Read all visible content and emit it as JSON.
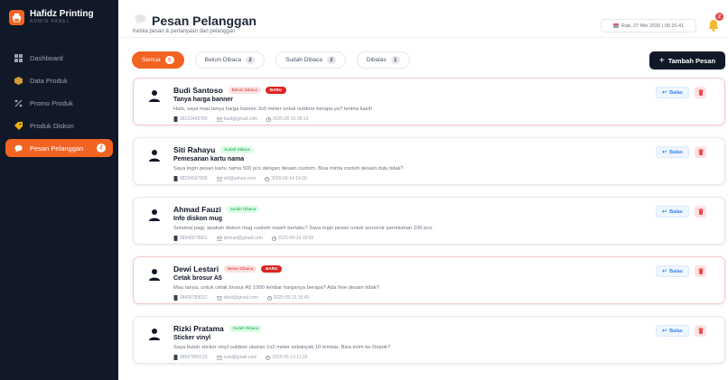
{
  "brand": {
    "title": "Hafidz Printing",
    "subtitle": "ADMIN PANEL",
    "accent": "#f26322"
  },
  "sidebar": {
    "items": [
      {
        "label": "Dashboard",
        "icon": "grid-icon"
      },
      {
        "label": "Data Produk",
        "icon": "box-icon"
      },
      {
        "label": "Promo Produk",
        "icon": "percent-icon"
      },
      {
        "label": "Produk Diskon",
        "icon": "tag-icon"
      },
      {
        "label": "Pesan Pelanggan",
        "icon": "chat-icon",
        "active": true,
        "badge": "2"
      }
    ]
  },
  "header": {
    "title": "Pesan Pelanggan",
    "subtitle": "Kelola pesan & pertanyaan dari pelanggan",
    "datetime": "Rab, 27 Mei 2026 | 09.20.41",
    "notification_count": "2"
  },
  "filters": [
    {
      "label": "Semua",
      "count": "5",
      "active": true
    },
    {
      "label": "Belum Dibaca",
      "count": "2"
    },
    {
      "label": "Sudah Dibaca",
      "count": "2"
    },
    {
      "label": "Dibalas",
      "count": "1"
    }
  ],
  "actions": {
    "add_label": "Tambah Pesan",
    "reply_label": "Balas"
  },
  "messages": [
    {
      "name": "Budi Santoso",
      "status": "Belum Dibaca",
      "is_new": true,
      "new_label": "BARU",
      "subject": "Tanya harga banner",
      "message": "Halo, saya mau tanya harga banner 3x5 meter untuk outdoor berapa ya? terima kasih",
      "phone": "08123456789",
      "email": "budi@gmail.com",
      "date": "2025-05-15 09:12"
    },
    {
      "name": "Siti Rahayu",
      "status": "Sudah Dibaca",
      "is_new": false,
      "subject": "Pemesanan kartu nama",
      "message": "Saya ingin pesan kartu nama 500 pcs dengan desain custom. Bisa minta contoh desain dulu tidak?",
      "phone": "08234567890",
      "email": "siti@yahoo.com",
      "date": "2025-05-14 14:30"
    },
    {
      "name": "Ahmad Fauzi",
      "status": "Sudah Dibaca",
      "is_new": false,
      "subject": "Info diskon mug",
      "message": "Selamat pagi, apakah diskon mug custom masih berlaku? Saya ingin pesan untuk souvenir pernikahan 100 pcs.",
      "phone": "08345678901",
      "email": "ahmad@gmail.com",
      "date": "2025-05-14 10:05"
    },
    {
      "name": "Dewi Lestari",
      "status": "Belum Dibaca",
      "is_new": true,
      "new_label": "BARU",
      "subject": "Cetak brosur A5",
      "message": "Mau tanya, untuk cetak brosur A5 1000 lembar harganya berapa? Ada free desain tidak?",
      "phone": "08456789012",
      "email": "dewi@gmail.com",
      "date": "2025-05-13 16:45"
    },
    {
      "name": "Rizki Pratama",
      "status": "Sudah Dibaca",
      "is_new": false,
      "subject": "Sticker vinyl",
      "message": "Saya butuh sticker vinyl outdoor ukuran 1x2 meter sebanyak 10 lembar. Bisa kirim ke Depok?",
      "phone": "08567890123",
      "email": "rizki@gmail.com",
      "date": "2025-05-13 11:20"
    }
  ]
}
